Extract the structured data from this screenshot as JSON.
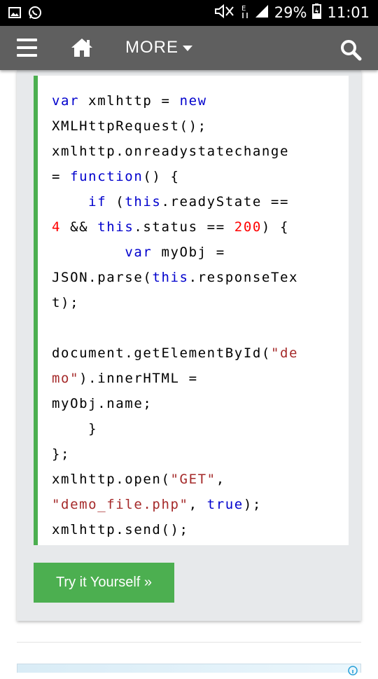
{
  "status_bar": {
    "battery_percent": "29%",
    "time": "11:01",
    "icons": [
      "gallery-icon",
      "whatsapp-icon",
      "mute-icon",
      "data-e-icon",
      "signal-icon",
      "battery-icon"
    ]
  },
  "nav": {
    "more_label": "MORE",
    "icons": [
      "menu-icon",
      "home-icon",
      "caret-down-icon",
      "search-icon"
    ]
  },
  "code_lines": [
    [
      {
        "t": "var",
        "c": "kw"
      },
      {
        "t": " xmlhttp = "
      },
      {
        "t": "new",
        "c": "kw"
      }
    ],
    [
      {
        "t": "XMLHttpRequest();"
      }
    ],
    [
      {
        "t": "xmlhttp.onreadystatechange"
      }
    ],
    [
      {
        "t": "= "
      },
      {
        "t": "function",
        "c": "kw"
      },
      {
        "t": "() {"
      }
    ],
    [
      {
        "t": "    "
      },
      {
        "t": "if",
        "c": "kw"
      },
      {
        "t": " ("
      },
      {
        "t": "this",
        "c": "kw"
      },
      {
        "t": ".readyState =="
      }
    ],
    [
      {
        "t": "4",
        "c": "num"
      },
      {
        "t": " && "
      },
      {
        "t": "this",
        "c": "kw"
      },
      {
        "t": ".status == "
      },
      {
        "t": "200",
        "c": "num"
      },
      {
        "t": ") {"
      }
    ],
    [
      {
        "t": "        "
      },
      {
        "t": "var",
        "c": "kw"
      },
      {
        "t": " myObj ="
      }
    ],
    [
      {
        "t": "JSON.parse("
      },
      {
        "t": "this",
        "c": "kw"
      },
      {
        "t": ".responseTex"
      }
    ],
    [
      {
        "t": "t);"
      }
    ],
    [],
    [
      {
        "t": "document.getElementById("
      },
      {
        "t": "\"de",
        "c": "str"
      }
    ],
    [
      {
        "t": "mo\"",
        "c": "str"
      },
      {
        "t": ").innerHTML ="
      }
    ],
    [
      {
        "t": "myObj.name;"
      }
    ],
    [
      {
        "t": "    }"
      }
    ],
    [
      {
        "t": "};"
      }
    ],
    [
      {
        "t": "xmlhttp.open("
      },
      {
        "t": "\"GET\"",
        "c": "str"
      },
      {
        "t": ","
      }
    ],
    [
      {
        "t": "\"demo_file.php\"",
        "c": "str"
      },
      {
        "t": ", "
      },
      {
        "t": "true",
        "c": "kw"
      },
      {
        "t": ");"
      }
    ],
    [
      {
        "t": "xmlhttp.send();"
      }
    ]
  ],
  "try_button_label": "Try it Yourself »",
  "colors": {
    "accent_green": "#4caf50",
    "navbar": "#5f5f5f",
    "keyword": "#0000cd",
    "number": "#ff0000",
    "string": "#a52a2a",
    "card_bg": "#e7e9eb"
  }
}
